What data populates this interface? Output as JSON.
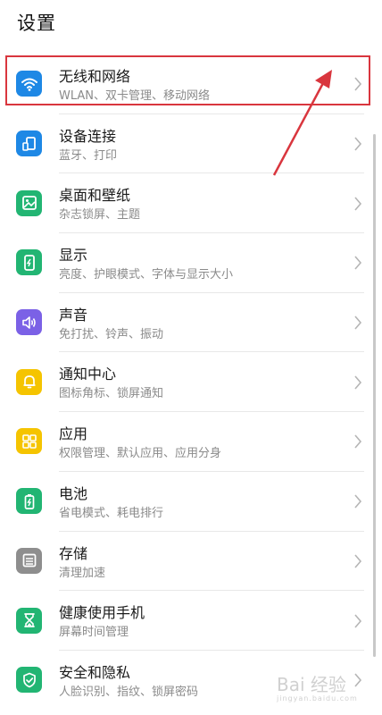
{
  "header": {
    "title": "设置"
  },
  "items": [
    {
      "title": "无线和网络",
      "subtitle": "WLAN、双卡管理、移动网络",
      "icon": "wifi-icon",
      "color": "#1e88e5"
    },
    {
      "title": "设备连接",
      "subtitle": "蓝牙、打印",
      "icon": "device-connection-icon",
      "color": "#1e88e5"
    },
    {
      "title": "桌面和壁纸",
      "subtitle": "杂志锁屏、主题",
      "icon": "wallpaper-icon",
      "color": "#22b573"
    },
    {
      "title": "显示",
      "subtitle": "亮度、护眼模式、字体与显示大小",
      "icon": "display-icon",
      "color": "#22b573"
    },
    {
      "title": "声音",
      "subtitle": "免打扰、铃声、振动",
      "icon": "sound-icon",
      "color": "#7b61e6"
    },
    {
      "title": "通知中心",
      "subtitle": "图标角标、锁屏通知",
      "icon": "bell-icon",
      "color": "#f5c400"
    },
    {
      "title": "应用",
      "subtitle": "权限管理、默认应用、应用分身",
      "icon": "apps-icon",
      "color": "#f5c400"
    },
    {
      "title": "电池",
      "subtitle": "省电模式、耗电排行",
      "icon": "battery-icon",
      "color": "#22b573"
    },
    {
      "title": "存储",
      "subtitle": "清理加速",
      "icon": "storage-icon",
      "color": "#8e8e8e"
    },
    {
      "title": "健康使用手机",
      "subtitle": "屏幕时间管理",
      "icon": "hourglass-icon",
      "color": "#22b573"
    },
    {
      "title": "安全和隐私",
      "subtitle": "人脸识别、指纹、锁屏密码",
      "icon": "shield-icon",
      "color": "#22b573"
    }
  ],
  "annotation": {
    "highlight_color": "#d9363e"
  },
  "watermark": {
    "text": "Bai 经验",
    "sub": "jingyan.baidu.com"
  }
}
